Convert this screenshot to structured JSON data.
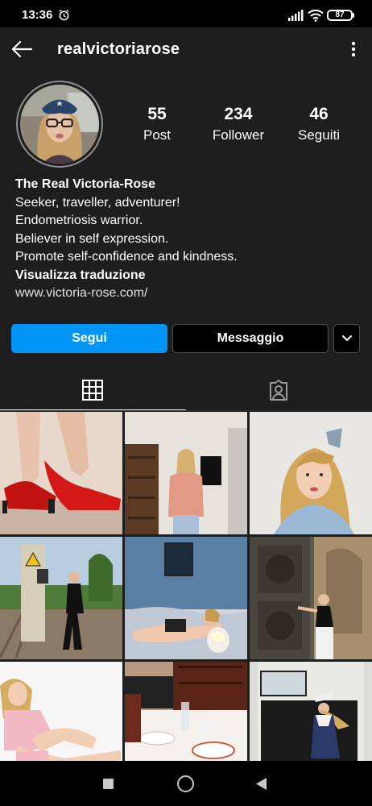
{
  "status_bar": {
    "time": "13:36",
    "battery": "87"
  },
  "header": {
    "username": "realvictoriarose"
  },
  "stats": [
    {
      "value": "55",
      "label": "Post"
    },
    {
      "value": "234",
      "label": "Follower"
    },
    {
      "value": "46",
      "label": "Seguiti"
    }
  ],
  "bio": {
    "name": "The Real Victoria-Rose",
    "lines": [
      "Seeker, traveller, adventurer!",
      "Endometriosis warrior.",
      "Believer in self expression.",
      "Promote self-confidence and kindness."
    ],
    "translate": "Visualizza traduzione",
    "link": "www.victoria-rose.com/"
  },
  "actions": {
    "follow": "Segui",
    "message": "Messaggio"
  },
  "tabs": {
    "grid_icon": "grid-icon",
    "tagged_icon": "tagged-person-icon"
  },
  "colors": {
    "accent": "#0095f6",
    "background": "#1e1e1e"
  },
  "grid": {
    "post_count_shown": 9
  }
}
